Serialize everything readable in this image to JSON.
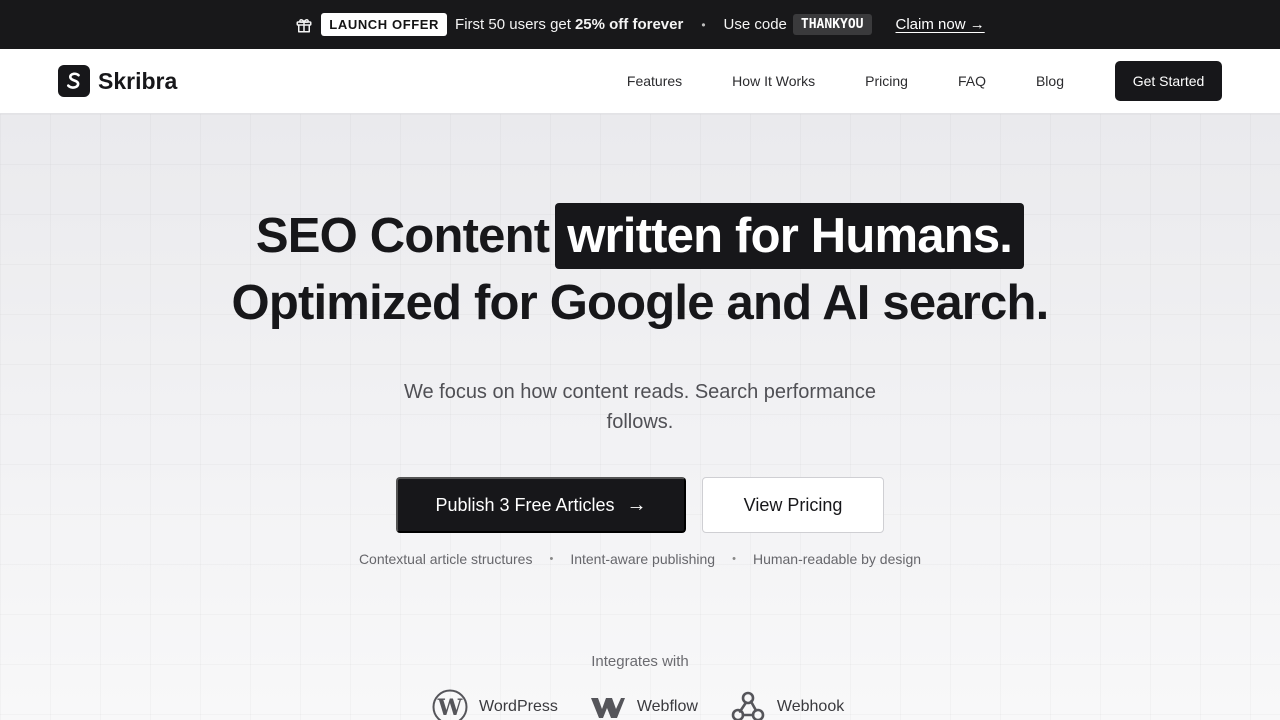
{
  "promo": {
    "badge": "LAUNCH OFFER",
    "text_prefix": "First 50 users get",
    "text_strong": "25% off forever",
    "code_label": "Use code",
    "code": "THANKYOU",
    "claim": "Claim now →"
  },
  "nav": {
    "brand": "Skribra",
    "links": [
      "Features",
      "How It Works",
      "Pricing",
      "FAQ",
      "Blog"
    ],
    "cta": "Get Started"
  },
  "hero": {
    "headline_part1": "SEO Content",
    "headline_highlight": "written for Humans.",
    "headline_line2": "Optimized for Google and AI search.",
    "subtitle": "We focus on how content reads. Search performance follows.",
    "primary_button": "Publish 3 Free Articles",
    "primary_arrow": "→",
    "secondary_button": "View Pricing",
    "features": [
      "Contextual article structures",
      "Intent-aware publishing",
      "Human-readable by design"
    ],
    "separator": "•",
    "integrates_label": "Integrates with",
    "integrations": [
      {
        "name": "WordPress",
        "icon": "wordpress-icon"
      },
      {
        "name": "Webflow",
        "icon": "webflow-icon"
      },
      {
        "name": "Webhook",
        "icon": "webhook-icon"
      }
    ]
  }
}
